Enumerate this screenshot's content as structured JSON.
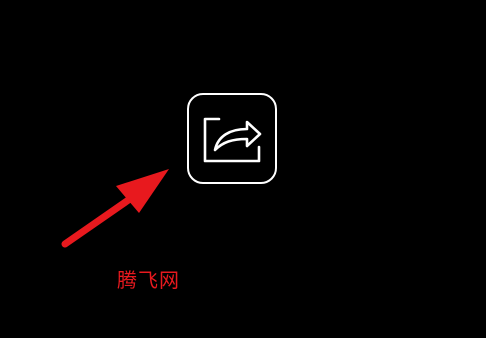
{
  "share": {
    "icon": "share-icon",
    "color": "#ffffff"
  },
  "annotation": {
    "icon": "arrow-icon",
    "color": "#e8191e"
  },
  "watermark": {
    "text": "腾飞网",
    "color": "#e8191e"
  }
}
